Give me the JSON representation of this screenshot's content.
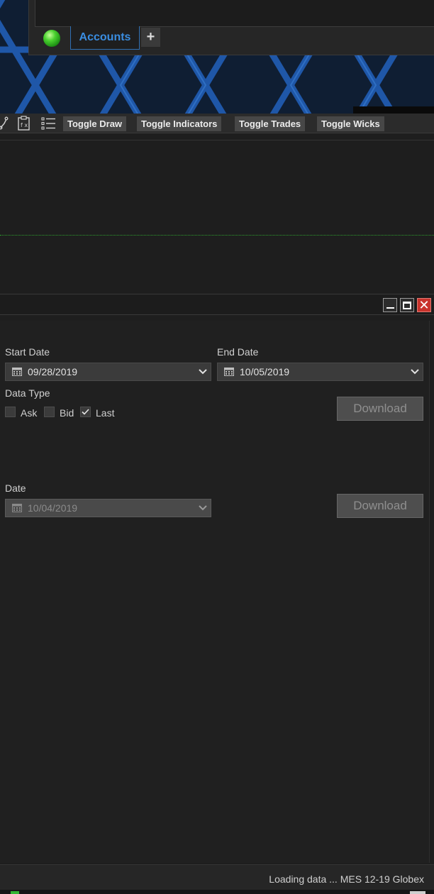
{
  "accounts": {
    "tab_label": "Accounts",
    "add_tab_label": "+"
  },
  "toolbar": {
    "buttons": [
      {
        "label": "Toggle Draw"
      },
      {
        "label": "Toggle Indicators"
      },
      {
        "label": "Toggle Trades"
      },
      {
        "label": "Toggle Wicks"
      }
    ]
  },
  "dialog": {
    "window_controls": [
      "minimize-icon",
      "maximize-icon",
      "close-icon"
    ],
    "close_glyph": "✕",
    "range": {
      "start_label": "Start Date",
      "start_value": "09/28/2019",
      "end_label": "End Date",
      "end_value": "10/05/2019",
      "data_type_label": "Data Type",
      "options": [
        {
          "label": "Ask",
          "checked": false
        },
        {
          "label": "Bid",
          "checked": false
        },
        {
          "label": "Last",
          "checked": true
        }
      ],
      "download_label": "Download"
    },
    "single": {
      "date_label": "Date",
      "date_value": "10/04/2019",
      "download_label": "Download"
    }
  },
  "status": {
    "text": "Loading data ... MES 12-19 Globex"
  },
  "colors": {
    "accent_blue": "#3a8de0",
    "connection_green": "#4ad12f",
    "close_red": "#c9332c",
    "dotted_line": "#2ea02e"
  }
}
